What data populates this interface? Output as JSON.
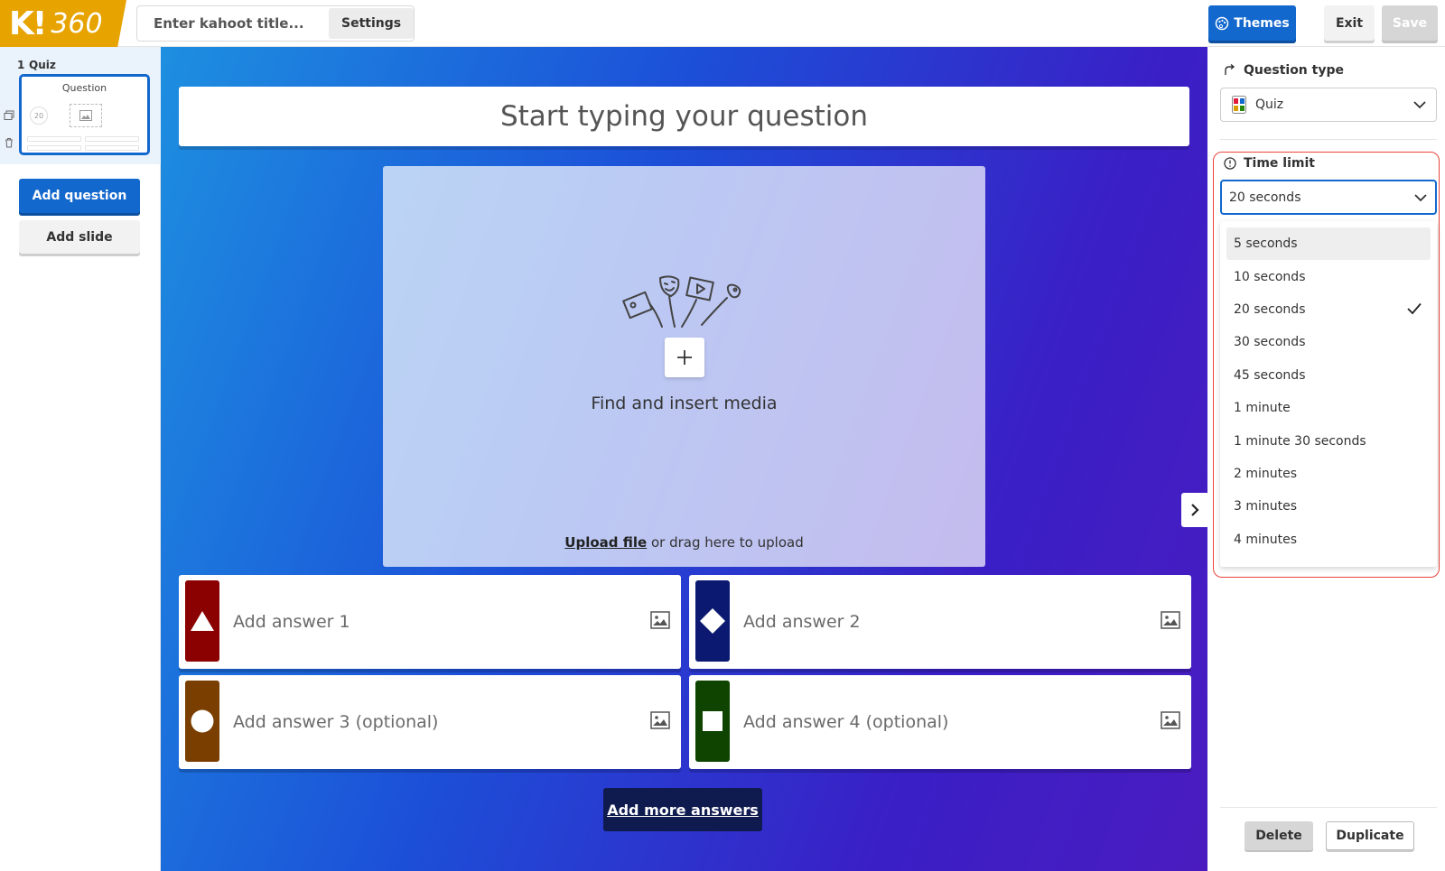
{
  "topbar": {
    "logo_k": "K!",
    "logo_360": "360",
    "title_placeholder": "Enter kahoot title...",
    "settings_label": "Settings",
    "themes_label": "Themes",
    "exit_label": "Exit",
    "save_label": "Save",
    "accent": "#1368ce"
  },
  "sidebar": {
    "slides": [
      {
        "number": "1",
        "type": "Quiz",
        "thumb_title": "Question",
        "thumb_timer": "20"
      }
    ],
    "add_question_label": "Add question",
    "add_slide_label": "Add slide"
  },
  "canvas": {
    "question_placeholder": "Start typing your question",
    "media_find_label": "Find and insert media",
    "upload_link": "Upload file",
    "upload_text": "or drag here to upload",
    "answers": [
      {
        "placeholder": "Add answer 1",
        "shape": "triangle",
        "color": "#8b0000"
      },
      {
        "placeholder": "Add answer 2",
        "shape": "diamond",
        "color": "#0b1a70"
      },
      {
        "placeholder": "Add answer 3 (optional)",
        "shape": "circle",
        "color": "#7a3e00"
      },
      {
        "placeholder": "Add answer 4 (optional)",
        "shape": "square",
        "color": "#0e4300"
      }
    ],
    "add_more_label": "Add more answers"
  },
  "panel": {
    "question_type_label": "Question type",
    "question_type_value": "Quiz",
    "time_limit_label": "Time limit",
    "time_limit_value": "20 seconds",
    "time_limit_options": [
      "5 seconds",
      "10 seconds",
      "20 seconds",
      "30 seconds",
      "45 seconds",
      "1 minute",
      "1 minute 30 seconds",
      "2 minutes",
      "3 minutes",
      "4 minutes"
    ],
    "hovered_option": "5 seconds",
    "selected_option": "20 seconds",
    "delete_label": "Delete",
    "duplicate_label": "Duplicate"
  }
}
